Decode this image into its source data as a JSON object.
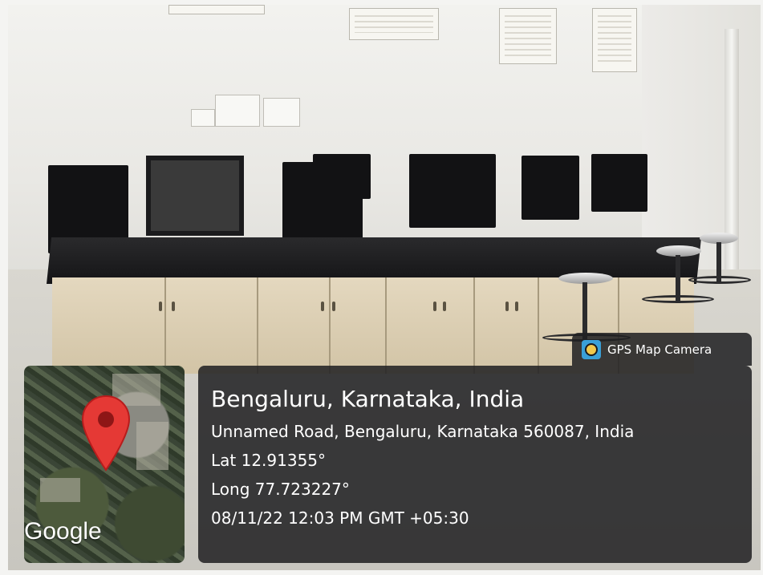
{
  "overlay": {
    "app_badge": {
      "label": "GPS Map Camera",
      "icon": "gps-map-camera-app-icon"
    },
    "map": {
      "logo_text": "Google",
      "pin_icon": "map-pin-icon",
      "pin_color": "#E53935"
    },
    "location": {
      "title": "Bengaluru, Karnataka, India",
      "address": "Unnamed Road, Bengaluru, Karnataka 560087, India",
      "latitude": "Lat 12.91355°",
      "longitude": "Long 77.723227°",
      "datetime": "08/11/22 12:03 PM GMT +05:30"
    },
    "panel_color": "#202022"
  }
}
